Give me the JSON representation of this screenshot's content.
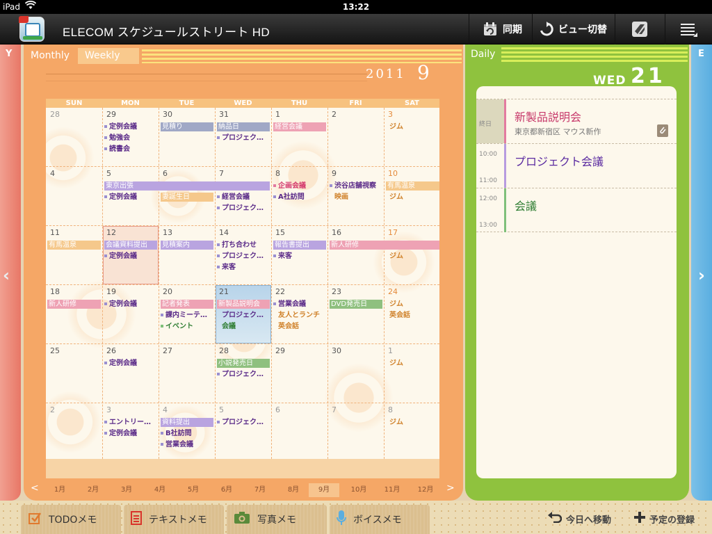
{
  "status_bar": {
    "device": "iPad",
    "time": "13:22"
  },
  "title_bar": {
    "app_title": "ELECOM スケジュールストリート HD",
    "sync_label": "同期",
    "view_switch_label": "ビュー切替",
    "icons": [
      "calendar-sync-icon",
      "refresh-icon",
      "evernote-icon",
      "menu-icon"
    ]
  },
  "side_tabs": {
    "left_label": "Y",
    "right_label": "E",
    "prev_glyph": "‹",
    "next_glyph": "›"
  },
  "monthly": {
    "tab_monthly": "Monthly",
    "tab_weekly": "Weekly",
    "year": "2011",
    "month": "9",
    "weekdays": [
      "SUN",
      "MON",
      "TUE",
      "WED",
      "THU",
      "FRI",
      "SAT"
    ],
    "weeks": [
      [
        "28",
        "29",
        "30",
        "31",
        "1",
        "2",
        "3"
      ],
      [
        "4",
        "5",
        "6",
        "7",
        "8",
        "9",
        "10"
      ],
      [
        "11",
        "12",
        "13",
        "14",
        "15",
        "16",
        "17"
      ],
      [
        "18",
        "19",
        "20",
        "21",
        "22",
        "23",
        "24"
      ],
      [
        "25",
        "26",
        "27",
        "28",
        "29",
        "30",
        "1"
      ],
      [
        "2",
        "3",
        "4",
        "5",
        "6",
        "7",
        "8"
      ]
    ],
    "events": {
      "w0_mon_1": "定例会議",
      "w0_mon_2": "勉強会",
      "w0_mon_3": "読書会",
      "w0_tue_bar": "見積り",
      "w0_wed_bar": "納品日",
      "w0_wed_1": "プロジェク…",
      "w0_thu_bar": "経営会議",
      "w0_sat_1": "ジム",
      "w1_bar": "東京出張",
      "w1_mon_1": "定例会議",
      "w1_tue_bar": "妻誕生日",
      "w1_wed_1": "経営会議",
      "w1_wed_2": "プロジェク…",
      "w1_thu_1": "企画会議",
      "w1_thu_2": "A社訪問",
      "w1_fri_1": "渋谷店舗視察",
      "w1_fri_2": "映画",
      "w1_sat_bar": "有馬温泉",
      "w1_sat_1": "ジム",
      "w2_sun_bar": "有馬温泉",
      "w2_mon_bar": "会議資料提出",
      "w2_mon_1": "定例会議",
      "w2_tue_bar": "見積案内",
      "w2_wed_1": "打ち合わせ",
      "w2_wed_2": "プロジェク…",
      "w2_wed_3": "来客",
      "w2_thu_bar": "報告書提出",
      "w2_thu_1": "来客",
      "w2_fri_bar": "新人研修",
      "w2_sat_1": "ジム",
      "w3_sun_bar": "新人研修",
      "w3_mon_1": "定例会議",
      "w3_tue_bar": "記者発表",
      "w3_tue_1": "課内ミーテ…",
      "w3_tue_2": "イベント",
      "w3_wed_bar": "新製品説明会",
      "w3_wed_1": "プロジェク…",
      "w3_wed_2": "会議",
      "w3_thu_1": "営業会議",
      "w3_thu_2": "友人とランチ",
      "w3_thu_3": "英会話",
      "w3_fri_bar": "DVD発売日",
      "w3_sat_1": "ジム",
      "w3_sat_2": "英会話",
      "w4_mon_1": "定例会議",
      "w4_wed_bar": "小説発売日",
      "w4_wed_1": "プロジェク…",
      "w4_sat_1": "ジム",
      "w5_mon_1": "エントリー…",
      "w5_mon_2": "定例会議",
      "w5_tue_bar": "資料提出",
      "w5_tue_1": "B社訪問",
      "w5_tue_2": "営業会議",
      "w5_wed_1": "プロジェク…",
      "w5_sat_1": "ジム"
    },
    "month_nav": [
      "1月",
      "2月",
      "3月",
      "4月",
      "5月",
      "6月",
      "7月",
      "8月",
      "9月",
      "10月",
      "11月",
      "12月"
    ],
    "selected_month": "9月"
  },
  "daily": {
    "tab_label": "Daily",
    "weekday": "WED",
    "day": "21",
    "entries": [
      {
        "time_label": "終日",
        "title": "新製品説明会",
        "subtitle": "東京都新宿区 マウス新作",
        "color": "#e37aa0"
      },
      {
        "start": "10:00",
        "end": "11:00",
        "title": "プロジェクト会議",
        "color": "#b79be0"
      },
      {
        "start": "12:00",
        "end": "13:00",
        "title": "会議",
        "color": "#7fc07a"
      }
    ]
  },
  "bottom_bar": {
    "todo": "TODOメモ",
    "text": "テキストメモ",
    "photo": "写真メモ",
    "voice": "ボイスメモ",
    "today": "今日へ移動",
    "add": "予定の登録"
  },
  "colors": {
    "monthly_panel": "#f5a766",
    "daily_panel": "#8fc23e",
    "left_tab": "#e87766",
    "right_tab": "#5aaee0"
  }
}
